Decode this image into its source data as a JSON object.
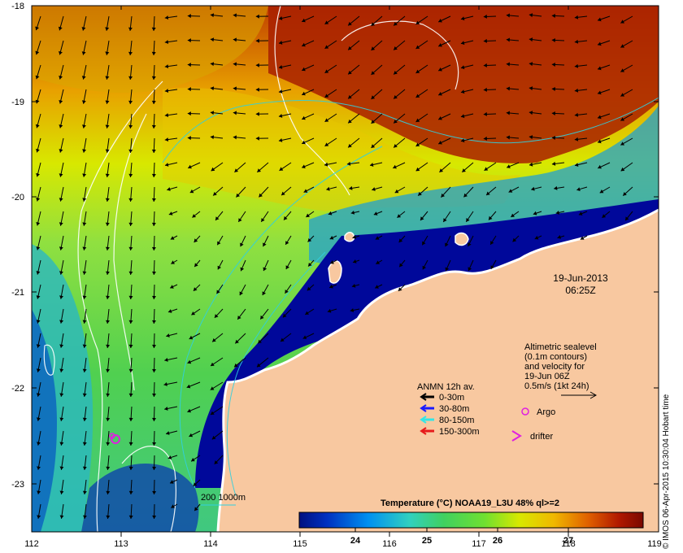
{
  "map": {
    "lon_ticks": [
      "112",
      "113",
      "114",
      "115",
      "116",
      "117",
      "118",
      "119"
    ],
    "lat_ticks": [
      "-18",
      "-19",
      "-20",
      "-21",
      "-22",
      "-23"
    ],
    "date": "19-Jun-2013",
    "time": "06:25Z",
    "altimetry_note": [
      "Altimetric sealevel",
      "(0.1m contours)",
      "and velocity for",
      "19-Jun 06Z",
      "0.5m/s (1kt 24h)"
    ],
    "anmn_title": "ANMN 12h av.",
    "anmn_items": [
      {
        "label": "0-30m",
        "color": "#000000"
      },
      {
        "label": "30-80m",
        "color": "#1a1aff"
      },
      {
        "label": "80-150m",
        "color": "#33e6e6"
      },
      {
        "label": "150-300m",
        "color": "#e61a1a"
      }
    ],
    "argo_label": "Argo",
    "drifter_label": "drifter",
    "bathy_label": "200  1000m",
    "colorbar": {
      "title": "Temperature (°C) NOAA19_L3U 48% ql>=2",
      "ticks": [
        "24",
        "25",
        "26",
        "27"
      ],
      "stops": [
        "#0a0a7a",
        "#0040d0",
        "#0098f0",
        "#20c8b8",
        "#40d880",
        "#60e040",
        "#a0e020",
        "#e8e800",
        "#f0b000",
        "#e06000",
        "#b01800",
        "#8a0a00"
      ]
    },
    "credit": "© IMOS 06-Apr-2015 10:30:04 Hobart time",
    "colors": {
      "land": "#f8c8a0",
      "marker": "#e020e0"
    }
  }
}
